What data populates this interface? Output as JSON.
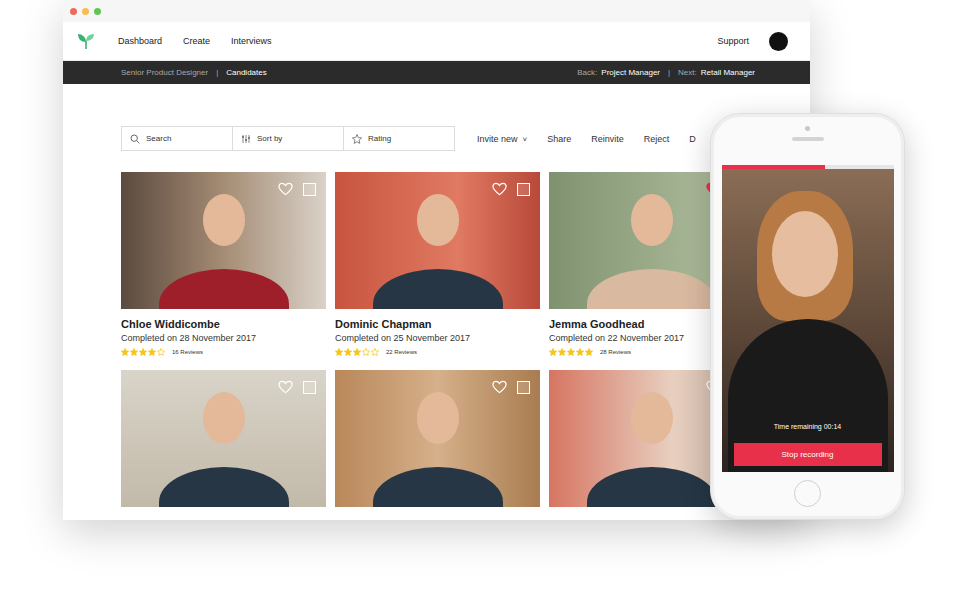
{
  "browser": {
    "dots": [
      {
        "color": "#ed6a5e"
      },
      {
        "color": "#f5bf4f"
      },
      {
        "color": "#61c554"
      }
    ]
  },
  "nav": {
    "items": [
      "Dashboard",
      "Create",
      "Interviews"
    ],
    "support": "Support"
  },
  "breadcrumb": {
    "role": "Senior Product Designer",
    "separator": "|",
    "section": "Candidates",
    "back_label": "Back:",
    "back": "Project Manager",
    "divider": "|",
    "next_label": "Next:",
    "next": "Retail Manager"
  },
  "toolbar": {
    "search": "Search",
    "sort": "Sort by",
    "rating": "Rating",
    "actions": [
      {
        "label": "Invite new",
        "caret": "˅"
      },
      {
        "label": "Share"
      },
      {
        "label": "Reinvite"
      },
      {
        "label": "Reject"
      },
      {
        "label": "D"
      }
    ]
  },
  "candidates": [
    {
      "name": "Chloe Widdicombe",
      "completed": "Completed on 28 November 2017",
      "stars": 4,
      "reviews": "16 Reviews",
      "favorite": false,
      "selected": false
    },
    {
      "name": "Dominic Chapman",
      "completed": "Completed on 25 November 2017",
      "stars": 3,
      "reviews": "22 Reviews",
      "favorite": false,
      "selected": false
    },
    {
      "name": "Jemma Goodhead",
      "completed": "Completed on 22 November 2017",
      "stars": 5,
      "reviews": "28 Reviews",
      "favorite": true,
      "selected": false
    },
    {
      "favorite": false,
      "selected": false
    },
    {
      "favorite": false,
      "selected": false
    },
    {
      "favorite": false,
      "selected": false
    }
  ],
  "phone": {
    "progress": 0.6,
    "time": "Time remaining 00:14",
    "button": "Stop recording"
  }
}
